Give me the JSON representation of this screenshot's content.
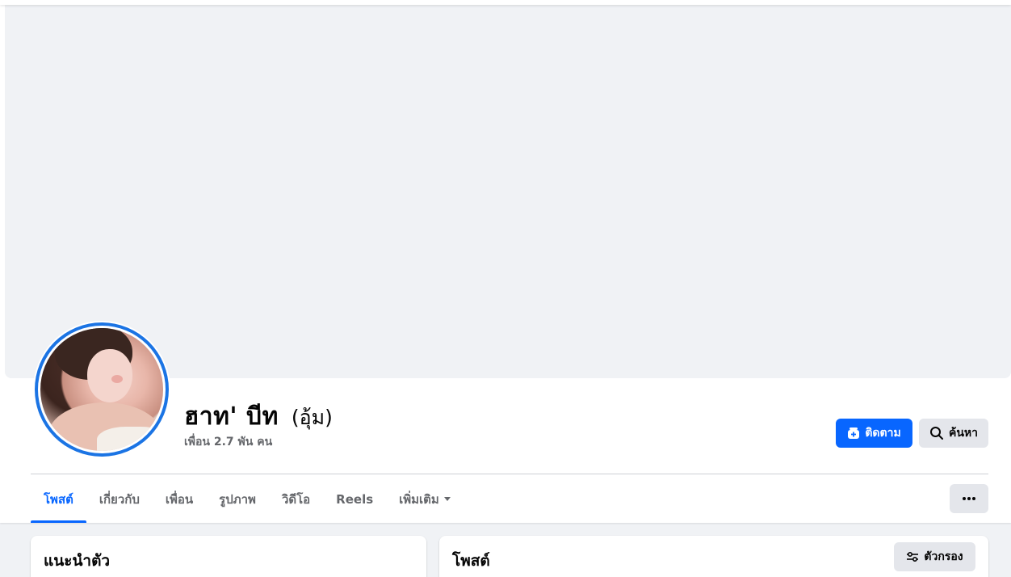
{
  "profile": {
    "name": "ฮาท' บีท",
    "alternate_name": "(อุ้ม)",
    "friends_count": "เพื่อน 2.7 พัน คน"
  },
  "actions": {
    "follow_label": "ติดตาม",
    "search_label": "ค้นหา"
  },
  "tabs": [
    {
      "label": "โพสต์",
      "active": true
    },
    {
      "label": "เกี่ยวกับ",
      "active": false
    },
    {
      "label": "เพื่อน",
      "active": false
    },
    {
      "label": "รูปภาพ",
      "active": false
    },
    {
      "label": "วิดีโอ",
      "active": false
    },
    {
      "label": "Reels",
      "active": false
    },
    {
      "label": "เพิ่มเติม",
      "active": false,
      "has_dropdown": true
    }
  ],
  "intro_card": {
    "title": "แนะนำตัว"
  },
  "posts_card": {
    "title": "โพสต์",
    "filter_label": "ตัวกรอง"
  },
  "colors": {
    "accent": "#0866ff",
    "avatar_ring": "#1b74e4",
    "secondary_text": "#65676b",
    "button_gray": "#e4e6eb",
    "background": "#f0f2f5"
  },
  "icons": {
    "follow": "follow-plus-icon",
    "search": "search-icon",
    "more": "more-dots-icon",
    "filter": "filter-sliders-icon",
    "dropdown": "caret-down-icon"
  }
}
